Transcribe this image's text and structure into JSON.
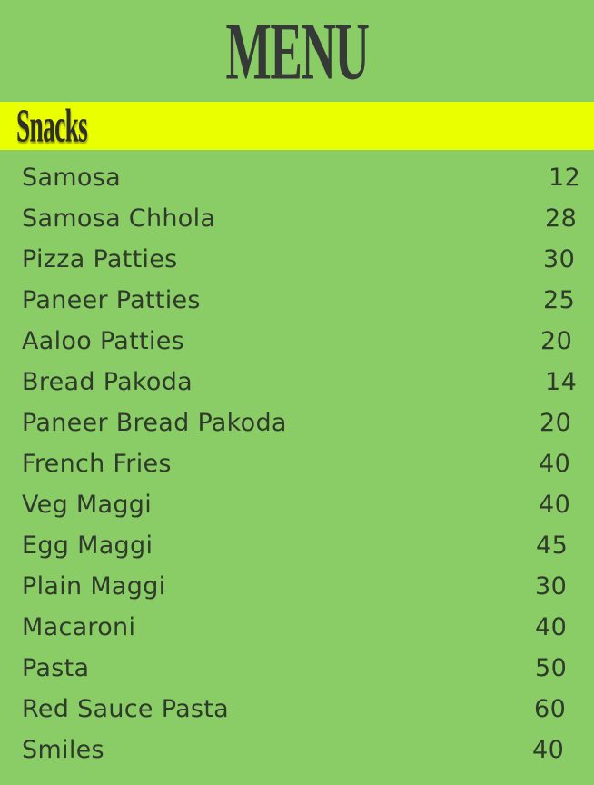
{
  "title": "MENU",
  "section": {
    "title": "Snacks",
    "items": [
      {
        "name": "Samosa",
        "price": "12"
      },
      {
        "name": "Samosa Chhola",
        "price": "28"
      },
      {
        "name": "Pizza Patties",
        "price": "30"
      },
      {
        "name": "Paneer Patties",
        "price": "25"
      },
      {
        "name": "Aaloo Patties",
        "price": "20"
      },
      {
        "name": "Bread Pakoda",
        "price": "14"
      },
      {
        "name": "Paneer Bread Pakoda",
        "price": "20"
      },
      {
        "name": "French Fries",
        "price": "40"
      },
      {
        "name": "Veg Maggi",
        "price": "40"
      },
      {
        "name": "Egg Maggi",
        "price": "45"
      },
      {
        "name": "Plain Maggi",
        "price": "30"
      },
      {
        "name": "Macaroni",
        "price": "40"
      },
      {
        "name": "Pasta",
        "price": "50"
      },
      {
        "name": "Red Sauce Pasta",
        "price": "60"
      },
      {
        "name": "Smiles",
        "price": "40"
      }
    ]
  },
  "colors": {
    "background": "#8acd66",
    "section_bar": "#eaff00",
    "text": "#2f3a2b"
  }
}
